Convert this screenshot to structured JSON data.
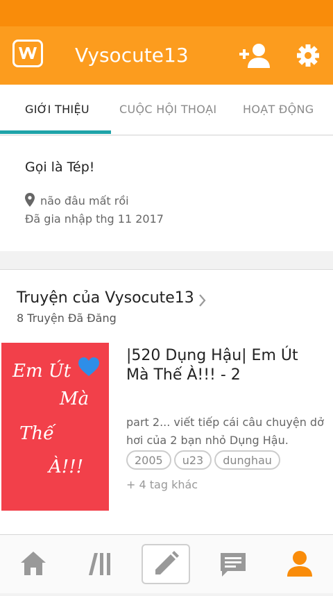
{
  "header": {
    "username": "Vysocute13"
  },
  "tabs": [
    {
      "label": "GIỚI THIỆU",
      "active": true
    },
    {
      "label": "CUỘC HỘI THOẠI",
      "active": false
    },
    {
      "label": "HOẠT ĐỘNG",
      "active": false
    }
  ],
  "profile": {
    "bio": "Gọi là Tép!",
    "location": "não đâu mất rồi",
    "joined": "Đã gia nhập thg 11 2017"
  },
  "stories_section": {
    "title": "Truyện của Vysocute13",
    "count": "8 Truyện Đã Đăng"
  },
  "story": {
    "title": "|520 Dụng Hậu| Em Út Mà Thế À!!! - 2",
    "cover_text": [
      "Em Út",
      "Mà",
      "Thế",
      "À!!!"
    ],
    "description": "part 2... viết tiếp cái câu chuyện dở hơi của 2 bạn nhỏ Dụng Hậu.",
    "tags": [
      "2005",
      "u23",
      "dunghau"
    ],
    "more_tags": "+ 4 tag khác"
  },
  "colors": {
    "status_bar": "#f98c0a",
    "app_bar": "#fc9c1e",
    "tab_indicator": "#1fa3a8",
    "cover_bg": "#f2404a",
    "active_nav": "#f98c0a"
  },
  "bottom_nav": [
    {
      "icon": "home-icon"
    },
    {
      "icon": "library-icon"
    },
    {
      "icon": "pencil-icon"
    },
    {
      "icon": "messages-icon"
    },
    {
      "icon": "profile-icon",
      "active": true
    }
  ]
}
